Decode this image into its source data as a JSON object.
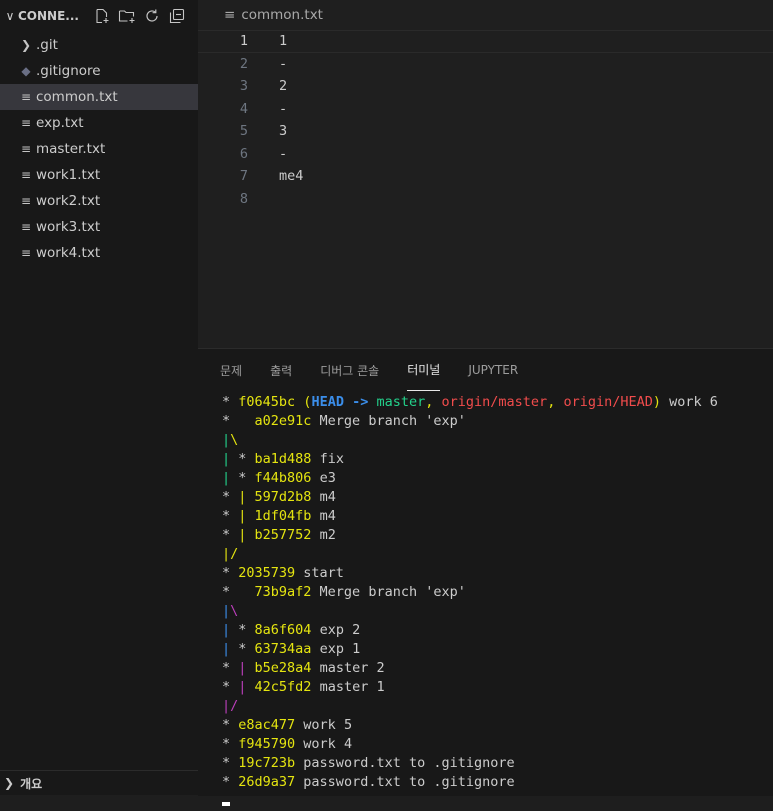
{
  "sidebar": {
    "title": "CONNE...",
    "items": [
      {
        "label": ".git",
        "icon": "chevron-right-icon"
      },
      {
        "label": ".gitignore",
        "icon": "git-diamond-icon"
      },
      {
        "label": "common.txt",
        "icon": "lines-icon"
      },
      {
        "label": "exp.txt",
        "icon": "lines-icon"
      },
      {
        "label": "master.txt",
        "icon": "lines-icon"
      },
      {
        "label": "work1.txt",
        "icon": "lines-icon"
      },
      {
        "label": "work2.txt",
        "icon": "lines-icon"
      },
      {
        "label": "work3.txt",
        "icon": "lines-icon"
      },
      {
        "label": "work4.txt",
        "icon": "lines-icon"
      }
    ],
    "selected_index": 2,
    "footer": {
      "outline_label": "개요"
    }
  },
  "editor": {
    "breadcrumb": "common.txt",
    "lines": [
      {
        "num": "1",
        "text": "1"
      },
      {
        "num": "2",
        "text": "-"
      },
      {
        "num": "3",
        "text": "2"
      },
      {
        "num": "4",
        "text": "-"
      },
      {
        "num": "5",
        "text": "3"
      },
      {
        "num": "6",
        "text": "-"
      },
      {
        "num": "7",
        "text": "me4"
      },
      {
        "num": "8",
        "text": ""
      }
    ]
  },
  "panel": {
    "tabs": [
      "문제",
      "출력",
      "디버그 콘솔",
      "터미널",
      "JUPYTER"
    ],
    "active_tab": "터미널"
  },
  "terminal": {
    "lines": [
      [
        {
          "t": "* ",
          "c": ""
        },
        {
          "t": "f0645bc",
          "c": "y"
        },
        {
          "t": " (",
          "c": "y"
        },
        {
          "t": "HEAD -> ",
          "c": "bb"
        },
        {
          "t": "master",
          "c": "g"
        },
        {
          "t": ", ",
          "c": "y"
        },
        {
          "t": "origin/master",
          "c": "r"
        },
        {
          "t": ", ",
          "c": "y"
        },
        {
          "t": "origin/HEAD",
          "c": "r"
        },
        {
          "t": ")",
          "c": "y"
        },
        {
          "t": " work 6",
          "c": ""
        }
      ],
      [
        {
          "t": "*   ",
          "c": ""
        },
        {
          "t": "a02e91c",
          "c": "y"
        },
        {
          "t": " Merge branch 'exp'",
          "c": ""
        }
      ],
      [
        {
          "t": "|",
          "c": "g"
        },
        {
          "t": "\\",
          "c": "y"
        }
      ],
      [
        {
          "t": "| ",
          "c": "g"
        },
        {
          "t": "* ",
          "c": ""
        },
        {
          "t": "ba1d488",
          "c": "y"
        },
        {
          "t": " fix",
          "c": ""
        }
      ],
      [
        {
          "t": "| ",
          "c": "g"
        },
        {
          "t": "* ",
          "c": ""
        },
        {
          "t": "f44b806",
          "c": "y"
        },
        {
          "t": " e3",
          "c": ""
        }
      ],
      [
        {
          "t": "* ",
          "c": ""
        },
        {
          "t": "| ",
          "c": "y"
        },
        {
          "t": "597d2b8",
          "c": "y"
        },
        {
          "t": " m4",
          "c": ""
        }
      ],
      [
        {
          "t": "* ",
          "c": ""
        },
        {
          "t": "| ",
          "c": "y"
        },
        {
          "t": "1df04fb",
          "c": "y"
        },
        {
          "t": " m4",
          "c": ""
        }
      ],
      [
        {
          "t": "* ",
          "c": ""
        },
        {
          "t": "| ",
          "c": "y"
        },
        {
          "t": "b257752",
          "c": "y"
        },
        {
          "t": " m2",
          "c": ""
        }
      ],
      [
        {
          "t": "|/",
          "c": "y"
        }
      ],
      [
        {
          "t": "* ",
          "c": ""
        },
        {
          "t": "2035739",
          "c": "y"
        },
        {
          "t": " start",
          "c": ""
        }
      ],
      [
        {
          "t": "*   ",
          "c": ""
        },
        {
          "t": "73b9af2",
          "c": "y"
        },
        {
          "t": " Merge branch 'exp'",
          "c": ""
        }
      ],
      [
        {
          "t": "|",
          "c": "b"
        },
        {
          "t": "\\",
          "c": "m"
        }
      ],
      [
        {
          "t": "| ",
          "c": "b"
        },
        {
          "t": "* ",
          "c": ""
        },
        {
          "t": "8a6f604",
          "c": "y"
        },
        {
          "t": " exp 2",
          "c": ""
        }
      ],
      [
        {
          "t": "| ",
          "c": "b"
        },
        {
          "t": "* ",
          "c": ""
        },
        {
          "t": "63734aa",
          "c": "y"
        },
        {
          "t": " exp 1",
          "c": ""
        }
      ],
      [
        {
          "t": "* ",
          "c": ""
        },
        {
          "t": "| ",
          "c": "m"
        },
        {
          "t": "b5e28a4",
          "c": "y"
        },
        {
          "t": " master 2",
          "c": ""
        }
      ],
      [
        {
          "t": "* ",
          "c": ""
        },
        {
          "t": "| ",
          "c": "m"
        },
        {
          "t": "42c5fd2",
          "c": "y"
        },
        {
          "t": " master 1",
          "c": ""
        }
      ],
      [
        {
          "t": "|/",
          "c": "m"
        }
      ],
      [
        {
          "t": "* ",
          "c": ""
        },
        {
          "t": "e8ac477",
          "c": "y"
        },
        {
          "t": " work 5",
          "c": ""
        }
      ],
      [
        {
          "t": "* ",
          "c": ""
        },
        {
          "t": "f945790",
          "c": "y"
        },
        {
          "t": " work 4",
          "c": ""
        }
      ],
      [
        {
          "t": "* ",
          "c": ""
        },
        {
          "t": "19c723b",
          "c": "y"
        },
        {
          "t": " password.txt to .gitignore",
          "c": ""
        }
      ],
      [
        {
          "t": "* ",
          "c": ""
        },
        {
          "t": "26d9a37",
          "c": "y"
        },
        {
          "t": " password.txt to .gitignore",
          "c": ""
        }
      ]
    ]
  },
  "colors": {
    "hash_yellow": "#e5e510",
    "branch_green": "#23d18b",
    "remote_red": "#f14c4c",
    "head_blue": "#3b8eea",
    "graph_magenta": "#bc3fbc"
  }
}
